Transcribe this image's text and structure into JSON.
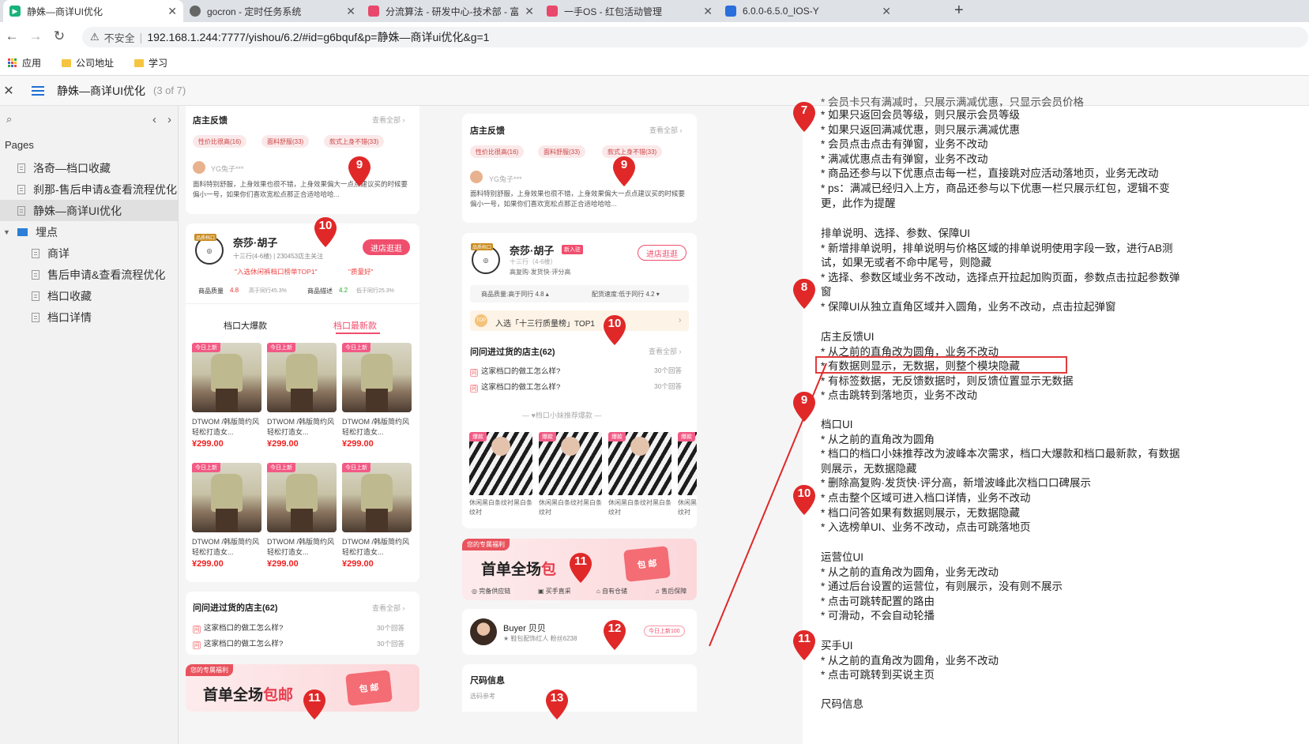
{
  "browser": {
    "tabs": [
      {
        "title": "静姝—商详UI优化",
        "active": true,
        "fav_color": "#19b27a"
      },
      {
        "title": "gocron - 定时任务系统",
        "active": false,
        "fav_color": "#666666"
      },
      {
        "title": "分流算法 - 研发中心-技术部 - 富",
        "active": false,
        "fav_color": "#e8486b"
      },
      {
        "title": "一手OS - 红包活动管理",
        "active": false,
        "fav_color": "#e8486b"
      },
      {
        "title": "6.0.0-6.5.0_IOS-Y",
        "active": false,
        "fav_color": "#2a6fdb"
      }
    ],
    "close_glyph": "✕",
    "new_tab_glyph": "+",
    "insecure_label": "不安全",
    "url": "192.168.1.244:7777/yishou/6.2/#id=g6bquf&p=静姝—商详ui优化&g=1",
    "bookmarks": [
      "应用",
      "公司地址",
      "学习"
    ]
  },
  "header": {
    "title": "静姝—商详UI优化",
    "page_count": "(3 of 7)"
  },
  "sidebar": {
    "section_title": "Pages",
    "items": [
      {
        "label": "洛奇—档口收藏",
        "level": 0,
        "type": "page"
      },
      {
        "label": "刹那-售后申请&查看流程优化",
        "level": 0,
        "type": "page"
      },
      {
        "label": "静姝—商详UI优化",
        "level": 0,
        "type": "page",
        "selected": true
      },
      {
        "label": "埋点",
        "level": 0,
        "type": "folder"
      },
      {
        "label": "商详",
        "level": 1,
        "type": "page"
      },
      {
        "label": "售后申请&查看流程优化",
        "level": 1,
        "type": "page"
      },
      {
        "label": "档口收藏",
        "level": 1,
        "type": "page"
      },
      {
        "label": "档口详情",
        "level": 1,
        "type": "page"
      }
    ]
  },
  "left_mock": {
    "feedback": {
      "title": "店主反馈",
      "more": "查看全部 ›",
      "tags": [
        "性价比很高(16)",
        "面料舒服(33)",
        "款式上身不错(33)"
      ],
      "user": "YG兔子***",
      "review": "面料特别舒服，上身效果也很不错，上身效果偏大一点点建议买的时候要偏小一号，如果你们喜欢宽松点那正合适哈哈哈..."
    },
    "store": {
      "badge": "品质档口",
      "name": "奈莎·胡子",
      "sub": "十三行(4-6楼) | 230453店主关注",
      "btn": "进店逛逛",
      "top1": "\"入选休闲裤档口榜单TOP1\"",
      "good": "\"质量好\"",
      "q1_label": "商品质量",
      "q1_val": "4.8",
      "q1_cmp": "高于同行45.3%",
      "q2_label": "商品描述",
      "q2_val": "4.2",
      "q2_cmp": "低于同行25.3%",
      "tab1": "档口大爆款",
      "tab2": "档口最新款"
    },
    "product": {
      "new": "今日上新",
      "name": "DTWOM /韩版简约风轻松打造女...",
      "price": "¥299.00"
    },
    "qa": {
      "title": "问问进过货的店主(62)",
      "more": "查看全部 ›",
      "q": "这家档口的做工怎么样?",
      "cnt": "30个回答"
    },
    "benefit": {
      "label": "您的专属福利",
      "text_a": "首单全场",
      "text_b": "包邮",
      "pkg": "包 邮"
    }
  },
  "right_mock": {
    "feedback": {
      "title": "店主反馈",
      "more": "查看全部 ›",
      "tags": [
        "性价比很高(16)",
        "面料舒服(33)",
        "款式上身不错(33)"
      ],
      "user": "YG兔子***",
      "review": "面料特别舒服，上身效果也很不错，上身效果偏大一点点建议买的时候要偏小一号，如果你们喜欢宽松点那正合适哈哈哈..."
    },
    "store": {
      "badge": "品质档口",
      "name": "奈莎·胡子",
      "new_tag": "新入驻",
      "sub1": "十三行（4-6楼）",
      "sub2": "高复购·发货快·评分高",
      "btn": "进店逛逛",
      "q1": "商品质量:高于同行 4.8 ▴",
      "q2": "配货速度:低于同行 4.2 ▾",
      "top1": "入选「十三行质量榜」TOP1",
      "top1_icon": "TOP"
    },
    "qa": {
      "title": "问问进过货的店主(62)",
      "more": "查看全部 ›",
      "q": "这家档口的做工怎么样?",
      "cnt": "30个回答"
    },
    "recommend": {
      "title": "— ♥档口小妹推荐爆款 —",
      "hot": "爆款",
      "name": "休闲黑白条纹衬黑白条纹衬"
    },
    "benefit": {
      "label": "您的专属福利",
      "text_a": "首单全场",
      "text_b": "包",
      "pkg": "包 邮",
      "features": [
        "完备供应链",
        "买手直采",
        "自有仓储",
        "售后保障"
      ]
    },
    "buyer": {
      "name": "Buyer 贝贝",
      "sub": "★ 鞋包配饰红人   粉丝6238",
      "tag": "今日上新100"
    },
    "size": {
      "title": "尺码信息",
      "sub": "选码参考"
    }
  },
  "pins": {
    "p7": "7",
    "p8": "8",
    "p9": "9",
    "p10": "10",
    "p11": "11",
    "p12": "12",
    "p13": "13"
  },
  "pin_color": "#e02828",
  "notes": {
    "cut_top": "* 会员卡只有满减时，只展示满减优惠，只显示会员价格",
    "s1": [
      "* 如果只返回会员等级，则只展示会员等级",
      "* 如果只返回满减优惠，则只展示满减优惠",
      "* 会员点击点击有弹窗，业务不改动",
      "* 满减优惠点击有弹窗，业务不改动",
      "* 商品还参与以下优惠点击每一栏，直接跳对应活动落地页，业务无改动",
      "* ps：满减已经归入上方，商品还参与以下优惠一栏只展示红包，逻辑不变",
      "更，此作为提醒"
    ],
    "s2_title": "排单说明、选择、参数、保障UI",
    "s2": [
      "* 新增排单说明，排单说明与价格区域的排单说明使用字段一致，进行AB测",
      "试，如果无或者不命中尾号，则隐藏",
      "* 选择、参数区域业务不改动，选择点开拉起加购页面，参数点击拉起参数弹",
      "窗",
      "* 保障UI从独立直角区域并入圆角，业务不改动，点击拉起弹窗"
    ],
    "s3_title": "店主反馈UI",
    "s3": [
      "* 从之前的直角改为圆角，业务不改动",
      "* 有数据则显示，无数据，则整个模块隐藏",
      "* 有标签数据，无反馈数据时，则反馈位置显示无数据",
      "* 点击跳转到落地页，业务不改动"
    ],
    "s4_title": "档口UI",
    "s4": [
      "* 从之前的直角改为圆角",
      "* 档口的档口小妹推荐改为波峰本次需求，档口大爆款和档口最新款，有数据",
      "则展示，无数据隐藏",
      "* 删除高复购·发货快·评分高，新增波峰此次档口口碑展示",
      "* 点击整个区域可进入档口详情，业务不改动",
      "* 档口问答如果有数据则展示，无数据隐藏",
      "* 入选榜单UI、业务不改动，点击可跳落地页"
    ],
    "s5_title": "运营位UI",
    "s5": [
      "* 从之前的直角改为圆角，业务无改动",
      "* 通过后台设置的运营位，有则展示，没有则不展示",
      "* 点击可跳转配置的路由",
      "* 可滑动，不会自动轮播"
    ],
    "s6_title": "买手UI",
    "s6": [
      "* 从之前的直角改为圆角，业务不改动",
      "* 点击可跳转到买说主页"
    ],
    "s7_title": "尺码信息"
  }
}
